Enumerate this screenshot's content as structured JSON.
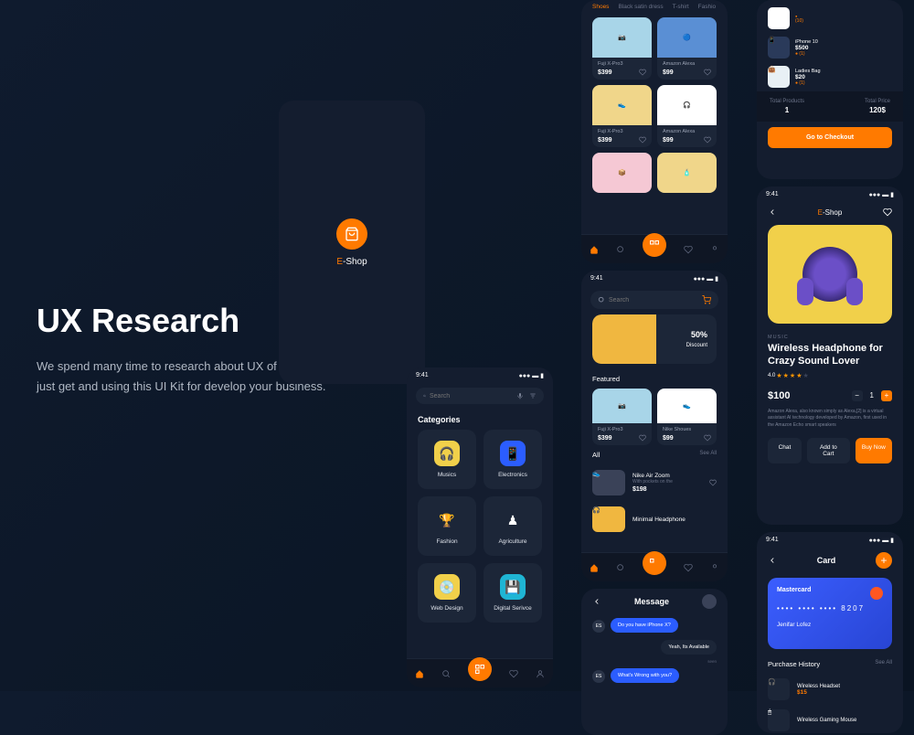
{
  "hero": {
    "title": "UX Research",
    "body": "We spend many time to research about UX of E-Commerce you just get and using this UI Kit for develop your business."
  },
  "splash": {
    "brand_e": "E",
    "brand_rest": "-Shop"
  },
  "status": {
    "time": "9:41"
  },
  "search": {
    "placeholder": "Search"
  },
  "categories": {
    "title": "Categories",
    "items": [
      {
        "name": "Musics"
      },
      {
        "name": "Electronics"
      },
      {
        "name": "Fashion"
      },
      {
        "name": "Agriculture"
      },
      {
        "name": "Web Design"
      },
      {
        "name": "Digital Serivce"
      }
    ]
  },
  "tabs": [
    "Shoes",
    "Black satin dress",
    "T-shirt",
    "Fashio"
  ],
  "products": [
    {
      "name": "Fuji X-Pro3",
      "price": "$399"
    },
    {
      "name": "Amazon Alexa",
      "price": "$99"
    },
    {
      "name": "Fuji X-Pro3",
      "price": "$399"
    },
    {
      "name": "Amazon Alexa",
      "price": "$99"
    }
  ],
  "hero_card": {
    "discount": "50%",
    "label": "Discount"
  },
  "featured": {
    "title": "Featured",
    "items": [
      {
        "name": "Fuji X-Pro3",
        "price": "$399"
      },
      {
        "name": "Nike Shoues",
        "price": "$99"
      }
    ]
  },
  "all": {
    "title": "All",
    "see_all": "See All",
    "items": [
      {
        "name": "Nike Air Zoom",
        "sub": "With pockets on the",
        "price": "$198"
      },
      {
        "name": "Minimal Headphone",
        "sub": "",
        "price": ""
      }
    ]
  },
  "message": {
    "title": "Message",
    "msgs": [
      {
        "who": "ES",
        "text": "Do you have iPhone X?",
        "me": false
      },
      {
        "text": "Yeah, Its Available",
        "me": true,
        "time": "seen"
      },
      {
        "who": "ES",
        "text": "What's Wrong with you?",
        "me": false
      }
    ]
  },
  "cart": {
    "items": [
      {
        "name": "iPhone 10",
        "price": "$500",
        "qty": "(1)"
      },
      {
        "name": "Ladies Bag",
        "price": "$20",
        "qty": "(1)"
      }
    ],
    "item0_qty": "(10)",
    "total_products_label": "Total Products",
    "total_products": "1",
    "total_price_label": "Total Price",
    "total_price": "120$",
    "checkout": "Go to Checkout"
  },
  "detail": {
    "brand_e": "E",
    "brand_rest": "-Shop",
    "category": "MUSIC",
    "title": "Wireless Headphone for Crazy Sound Lover",
    "rating": "4.0",
    "price": "$100",
    "qty": "1",
    "desc": "Amazon Alexa, also known simply as Alexa,[2] is a virtual assistant AI technology developed by Amazon, first used in the Amazon Echo smart speakers",
    "chat": "Chat",
    "add_cart": "Add to Cart",
    "buy": "Buy Now"
  },
  "card": {
    "title": "Card",
    "brand": "Mastercard",
    "number": "•••• •••• •••• 8207",
    "name": "Jenifar Lofez",
    "history_title": "Purchase History",
    "see_all": "See All",
    "history": [
      {
        "name": "Wireless Headset",
        "price": "$15"
      },
      {
        "name": "Wireless Gaming Mouse",
        "price": ""
      }
    ]
  }
}
